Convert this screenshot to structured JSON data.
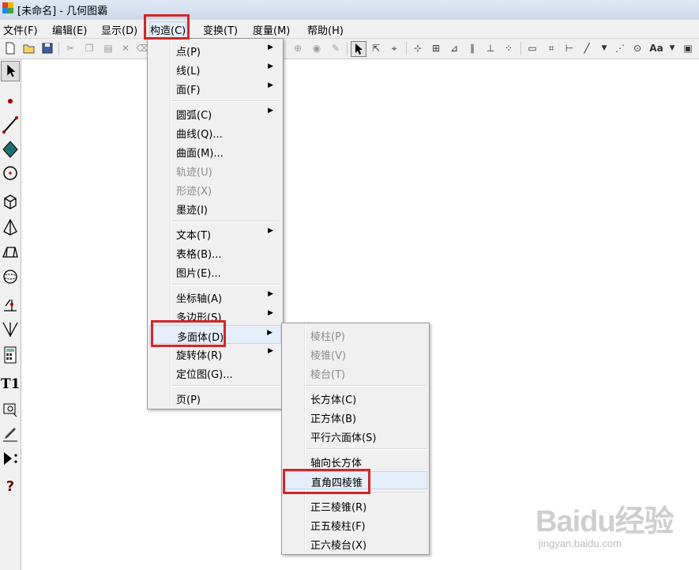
{
  "window": {
    "title": "[未命名] - 几何图霸"
  },
  "menubar": {
    "items": [
      {
        "label": "文件(F)"
      },
      {
        "label": "编辑(E)"
      },
      {
        "label": "显示(D)"
      },
      {
        "label": "构造(C)"
      },
      {
        "label": "变换(T)"
      },
      {
        "label": "度量(M)"
      },
      {
        "label": "帮助(H)"
      }
    ]
  },
  "construct_menu": {
    "items": [
      {
        "label": "点(P)",
        "submenu": true,
        "enabled": true
      },
      {
        "label": "线(L)",
        "submenu": true,
        "enabled": true
      },
      {
        "label": "面(F)",
        "submenu": true,
        "enabled": true
      },
      {
        "label": "圆弧(C)",
        "submenu": true,
        "enabled": true
      },
      {
        "label": "曲线(Q)...",
        "submenu": false,
        "enabled": true
      },
      {
        "label": "曲面(M)...",
        "submenu": false,
        "enabled": true
      },
      {
        "label": "轨迹(U)",
        "submenu": false,
        "enabled": false
      },
      {
        "label": "形迹(X)",
        "submenu": false,
        "enabled": false
      },
      {
        "label": "墨迹(I)",
        "submenu": false,
        "enabled": true
      },
      {
        "label": "文本(T)",
        "submenu": true,
        "enabled": true
      },
      {
        "label": "表格(B)...",
        "submenu": false,
        "enabled": true
      },
      {
        "label": "图片(E)...",
        "submenu": false,
        "enabled": true
      },
      {
        "label": "坐标轴(A)",
        "submenu": true,
        "enabled": true
      },
      {
        "label": "多边形(S)",
        "submenu": true,
        "enabled": true
      },
      {
        "label": "多面体(D)",
        "submenu": true,
        "enabled": true
      },
      {
        "label": "旋转体(R)",
        "submenu": true,
        "enabled": true
      },
      {
        "label": "定位图(G)...",
        "submenu": false,
        "enabled": true
      },
      {
        "label": "页(P)",
        "submenu": false,
        "enabled": true
      }
    ]
  },
  "polyhedron_submenu": {
    "items": [
      {
        "label": "棱柱(P)",
        "enabled": false
      },
      {
        "label": "棱锥(V)",
        "enabled": false
      },
      {
        "label": "棱台(T)",
        "enabled": false
      },
      {
        "label": "长方体(C)",
        "enabled": true
      },
      {
        "label": "正方体(B)",
        "enabled": true
      },
      {
        "label": "平行六面体(S)",
        "enabled": true
      },
      {
        "label": "轴向长方体",
        "enabled": true
      },
      {
        "label": "直角四棱锥",
        "enabled": true
      },
      {
        "label": "正三棱锥(R)",
        "enabled": true
      },
      {
        "label": "正五棱柱(F)",
        "enabled": true
      },
      {
        "label": "正六棱台(X)",
        "enabled": true
      }
    ]
  },
  "toolbar": {
    "font_button": "Aa"
  },
  "left_toolbox": {
    "text_tool": "T1",
    "help_tool": "?"
  },
  "watermark": {
    "brand": "Baidu经验",
    "url": "jingyan.baidu.com"
  },
  "colors": {
    "highlight_frame": "#d42626",
    "menu_background": "#f0f0f0",
    "disabled_text": "#8d8d8d"
  }
}
